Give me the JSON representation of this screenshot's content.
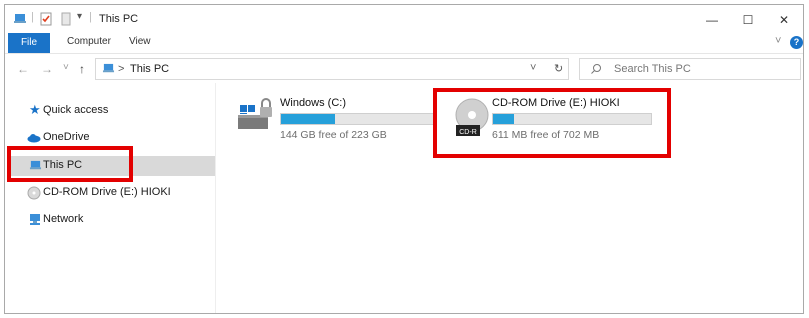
{
  "window": {
    "title": "This PC",
    "controls": {
      "minimize": "—",
      "maximize": "☐",
      "close": "✕"
    }
  },
  "ribbon": {
    "tabs": [
      "File",
      "Computer",
      "View"
    ],
    "expand_icon": "˅",
    "help_icon": "?"
  },
  "address": {
    "path_sep": ">",
    "location": "This PC",
    "dropdown_glyph": "˅",
    "refresh_glyph": "↻",
    "search_placeholder": "Search This PC"
  },
  "nav": {
    "back": "←",
    "forward": "→",
    "recent": "˅",
    "up": "↑",
    "items": [
      {
        "label": "Quick access",
        "icon": "star-icon"
      },
      {
        "label": "OneDrive",
        "icon": "cloud-icon"
      },
      {
        "label": "This PC",
        "icon": "computer-icon"
      },
      {
        "label": "CD-ROM Drive (E:) HIOKI",
        "icon": "cd-icon"
      },
      {
        "label": "Network",
        "icon": "network-icon"
      }
    ]
  },
  "drives": [
    {
      "name": "Windows (C:)",
      "free_text": "144 GB free of 223 GB",
      "used_fraction": 0.354,
      "icon": "windows-drive-icon"
    },
    {
      "name": "CD-ROM Drive (E:) HIOKI",
      "free_text": "611 MB free of 702 MB",
      "used_fraction": 0.13,
      "icon": "cd-rom-icon",
      "badge": "CD-R"
    }
  ],
  "colors": {
    "accent": "#1a73c8",
    "bar_fill": "#26a0da",
    "highlight": "#e30000",
    "selected": "#d9d9d9"
  }
}
